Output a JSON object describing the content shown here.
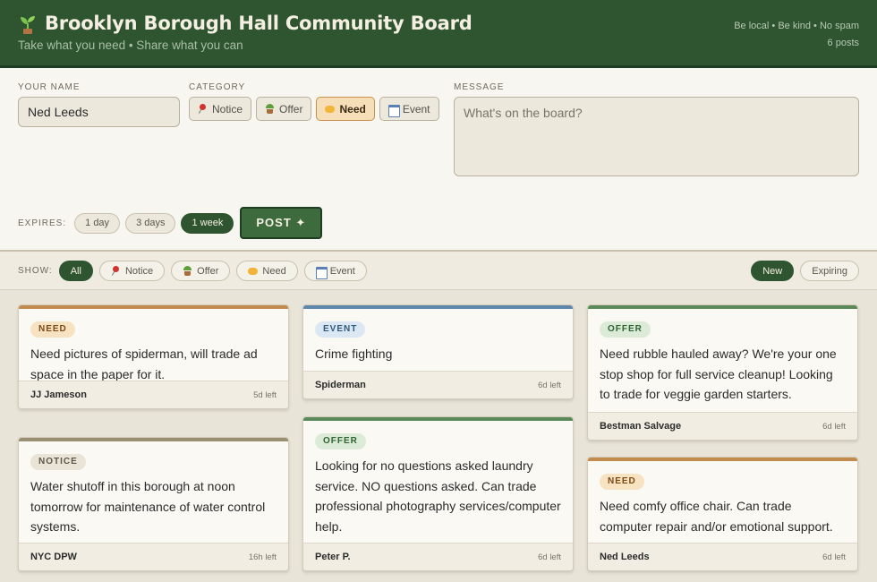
{
  "header": {
    "title": "Brooklyn Borough Hall Community Board",
    "subtitle": "Take what you need • Share what you can",
    "tagline": "Be local • Be kind • No spam",
    "post_count": "6 posts",
    "logo_icon": "sprout-icon"
  },
  "composer": {
    "name_label": "YOUR NAME",
    "name_value": "Ned Leeds",
    "category_label": "CATEGORY",
    "categories": [
      {
        "label": "Notice",
        "icon": "pin-icon",
        "active": false
      },
      {
        "label": "Offer",
        "icon": "sprout-icon",
        "active": false
      },
      {
        "label": "Need",
        "icon": "hand-icon",
        "active": true
      },
      {
        "label": "Event",
        "icon": "calendar-icon",
        "active": false
      }
    ],
    "message_label": "MESSAGE",
    "message_placeholder": "What's on the board?",
    "expires_label": "EXPIRES:",
    "expires_options": [
      "1 day",
      "3 days",
      "1 week"
    ],
    "expires_selected": "1 week",
    "post_label": "POST ✦"
  },
  "filters": {
    "show_label": "SHOW:",
    "options": [
      "All",
      "Notice",
      "Offer",
      "Need",
      "Event"
    ],
    "selected": "All",
    "sort_options": [
      "New",
      "Expiring"
    ],
    "sort_selected": "New"
  },
  "posts": [
    {
      "tag": "NEED",
      "body": "Need pictures of spiderman, will trade ad space in the paper for it.",
      "author": "JJ Jameson",
      "expires": "5d left"
    },
    {
      "tag": "NOTICE",
      "body": "Water shutoff in this borough at noon tomorrow for maintenance of water control systems.",
      "author": "NYC DPW",
      "expires": "16h left"
    },
    {
      "tag": "EVENT",
      "body": "Crime fighting",
      "author": "Spiderman",
      "expires": "6d left"
    },
    {
      "tag": "OFFER",
      "body": "Looking for no questions asked laundry service. NO questions asked. Can trade professional photography services/computer help.",
      "author": "Peter P.",
      "expires": "6d left"
    },
    {
      "tag": "OFFER",
      "body": "Need rubble hauled away? We're your one stop shop for full service cleanup! Looking to trade for veggie garden starters.",
      "author": "Bestman Salvage",
      "expires": "6d left"
    },
    {
      "tag": "NEED",
      "body": "Need comfy office chair. Can trade computer repair and/or emotional support.",
      "author": "Ned Leeds",
      "expires": "6d left"
    }
  ],
  "colors": {
    "header_bg": "#2e5530",
    "need": "#c38a4d",
    "event": "#5d88ac",
    "offer": "#5a8a5a",
    "notice": "#9a8e72"
  }
}
